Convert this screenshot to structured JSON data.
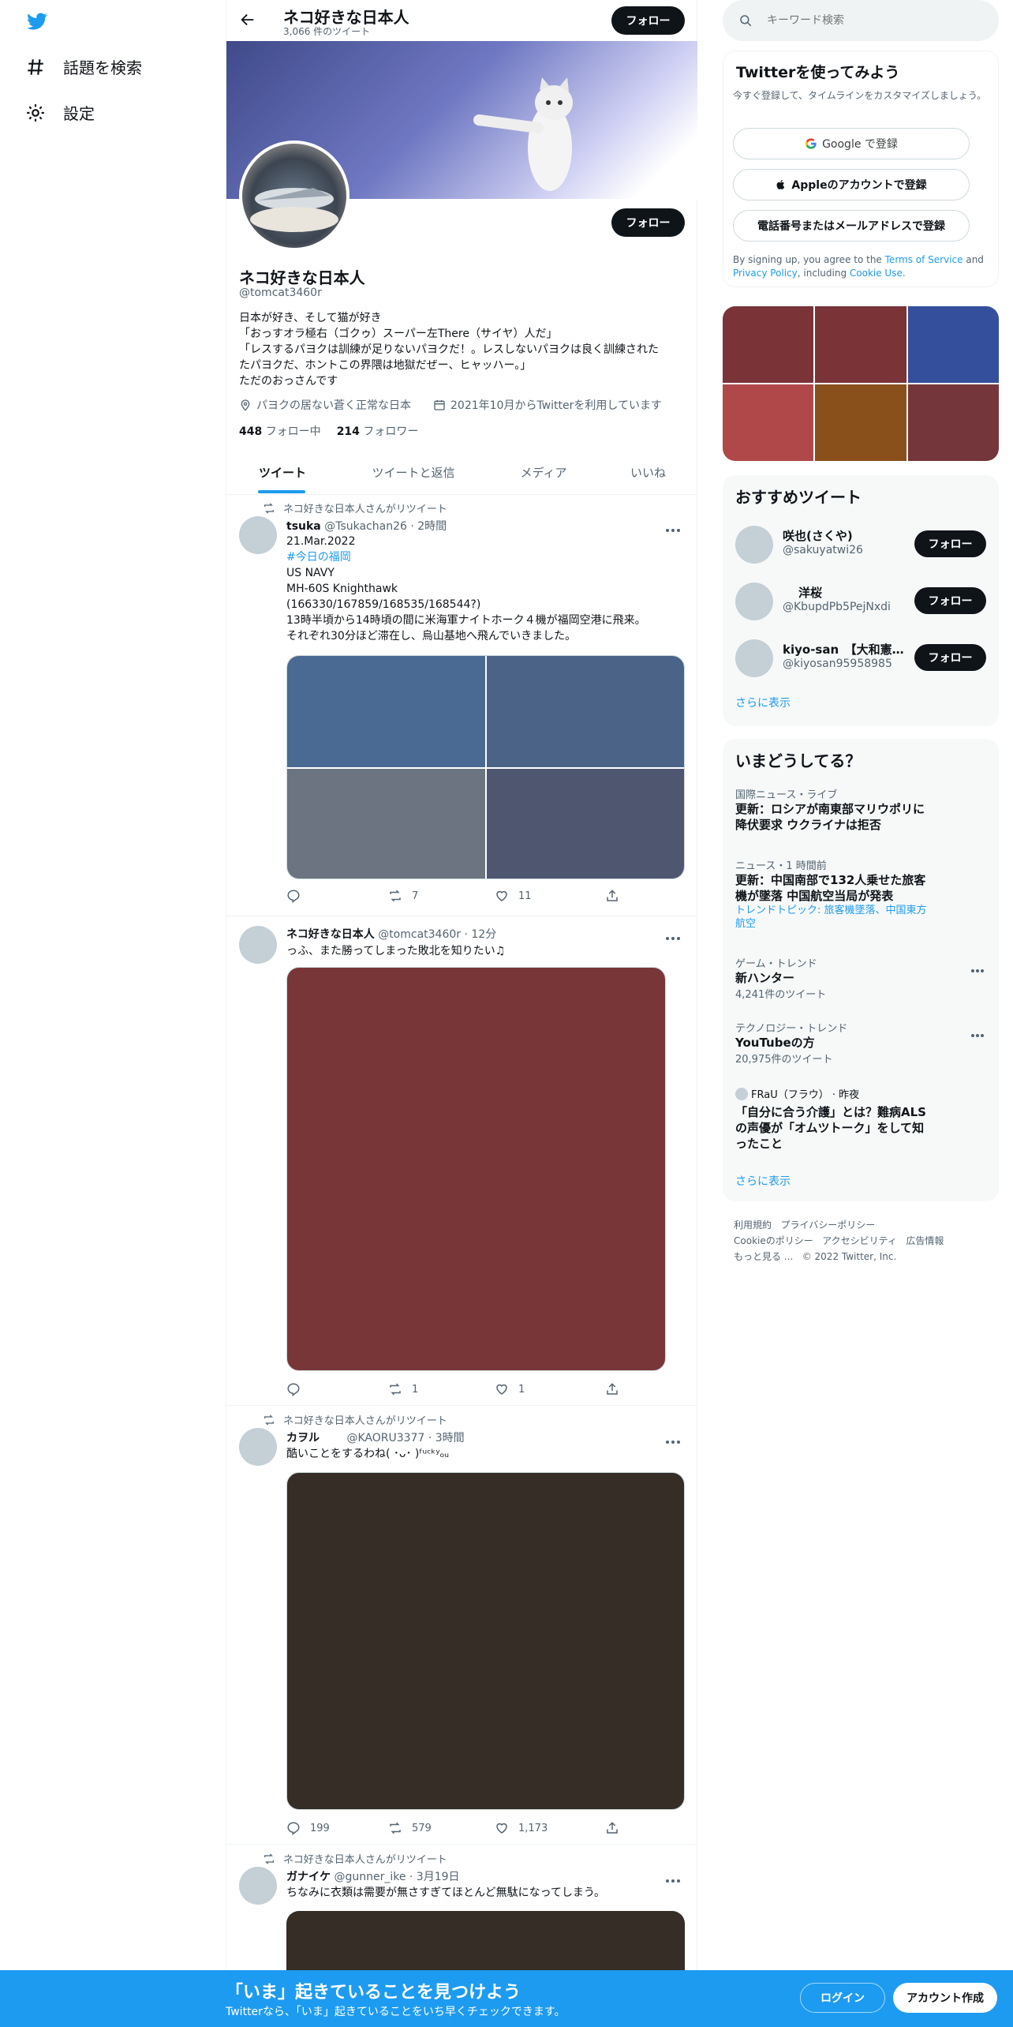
{
  "nav": {
    "explore_label": "話題を検索",
    "settings_label": "設定"
  },
  "header": {
    "name": "ネコ好きな日本人",
    "tweet_count": "3,066 件のツイート",
    "follow_label": "フォロー"
  },
  "profile": {
    "name": "ネコ好きな日本人",
    "handle": "@tomcat3460r",
    "bio": [
      "日本が好き、そして猫が好き",
      "「おっすオラ極右（ゴクゥ）スーパー左There（サイヤ）人だ」",
      "「レスするパヨクは訓練が足りないパヨクだ！。レスしないパヨクは良く訓練された",
      "たパヨクだ、ホントこの界隈は地獄だぜー、ヒャッハー。」",
      "ただのおっさんです"
    ],
    "location": "パヨクの居ない蒼く正常な日本",
    "joined": "2021年10月からTwitterを利用しています",
    "following_count": "448",
    "following_label": "フォロー中",
    "followers_count": "214",
    "followers_label": "フォロワー",
    "follow_label": "フォロー"
  },
  "tabs": [
    "ツイート",
    "ツイートと返信",
    "メディア",
    "いいね"
  ],
  "tweets": [
    {
      "retweet_label": "ネコ好きな日本人さんがリツイート",
      "name": "tsuka",
      "meta": "@Tsukachan26 · 2時間",
      "lines": [
        "21.Mar.2022",
        "#今日の福岡",
        "US NAVY",
        "MH-60S Knighthawk",
        "(166330/167859/168535/168544?)",
        "13時半頃から14時頃の間に米海軍ナイトホーク４機が福岡空港に飛来。",
        "それぞれ30分ほど滞在し、烏山基地へ飛んでいきました。"
      ],
      "reply": "",
      "retweets": "7",
      "likes": "11"
    },
    {
      "retweet_label": "",
      "name": "ネコ好きな日本人",
      "meta": "@tomcat3460r · 12分",
      "lines": [
        "っふ、また勝ってしまった敗北を知りたい♫"
      ],
      "reply": "",
      "retweets": "1",
      "likes": "1"
    },
    {
      "retweet_label": "ネコ好きな日本人さんがリツイート",
      "name": "カヲル",
      "meta": "@KAORU3377 · 3時間",
      "lines": [
        "酷いことをするわね( ･ᴗ･ )ᶠᵘᶜᵏʸₒᵤ"
      ],
      "reply": "199",
      "retweets": "579",
      "likes": "1,173"
    },
    {
      "retweet_label": "ネコ好きな日本人さんがリツイート",
      "name": "ガナイケ",
      "meta": "@gunner_ike · 3月19日",
      "lines": [
        "ちなみに衣類は需要が無さすぎてほとんど無駄になってしまう。"
      ],
      "reply": "",
      "retweets": "",
      "likes": ""
    }
  ],
  "search": {
    "placeholder": "キーワード検索"
  },
  "signup": {
    "title": "Twitterを使ってみよう",
    "subtitle": "今すぐ登録して、タイムラインをカスタマイズしましょう。",
    "google": "Google で登録",
    "apple": "Appleのアカウントで登録",
    "phone": "電話番号またはメールアドレスで登録",
    "terms_prefix": "By signing up, you agree to the ",
    "terms_link": "Terms of Service",
    "terms_mid": " and ",
    "privacy_link": "Privacy Policy",
    "terms_mid2": ", including ",
    "cookie_link": "Cookie Use."
  },
  "who_to_follow": {
    "title": "おすすめツイート",
    "users": [
      {
        "name": "咲也(さくや)",
        "handle": "@sakuyatwi26"
      },
      {
        "name": "洋桜",
        "handle": "@KbupdPb5PejNxdi"
      },
      {
        "name": "kiyo-san　【大和憲…",
        "handle": "@kiyosan95958985"
      }
    ],
    "follow_label": "フォロー",
    "more": "さらに表示"
  },
  "trends": {
    "title": "いまどうしてる？",
    "items": [
      {
        "category": "国際ニュース・ライブ",
        "title": "更新：ロシアが南東部マリウポリに降伏要求 ウクライナは拒否",
        "sub": ""
      },
      {
        "category": "ニュース・1 時間前",
        "title": "更新：中国南部で132人乗せた旅客機が墜落 中国航空当局が発表",
        "sub": "トレンドトピック: 旅客機墜落、中国東方航空"
      },
      {
        "category": "ゲーム・トレンド",
        "title": "新ハンター",
        "sub": "4,241件のツイート"
      },
      {
        "category": "テクノロジー・トレンド",
        "title": "YouTubeの方",
        "sub": "20,975件のツイート"
      },
      {
        "category": "FRaU（フラウ） · 昨夜",
        "title": "「自分に合う介護」とは？難病ALSの声優が「オムツトーク」をして知ったこと",
        "sub": ""
      }
    ],
    "more": "さらに表示"
  },
  "footer": {
    "links": [
      "利用規約",
      "プライバシーポリシー",
      "Cookieのポリシー",
      "アクセシビリティ",
      "広告情報",
      "もっと見る ...",
      "© 2022 Twitter, Inc."
    ]
  },
  "bottom_bar": {
    "title": "「いま」起きていることを見つけよう",
    "subtitle": "Twitterなら、「いま」起きていることをいち早くチェックできます。",
    "login": "ログイン",
    "signup": "アカウント作成"
  },
  "colors": {
    "accent": "#1d9bf0",
    "bottom_bar": "#1d9bf0",
    "text": "#0f1419",
    "muted": "#536471"
  }
}
